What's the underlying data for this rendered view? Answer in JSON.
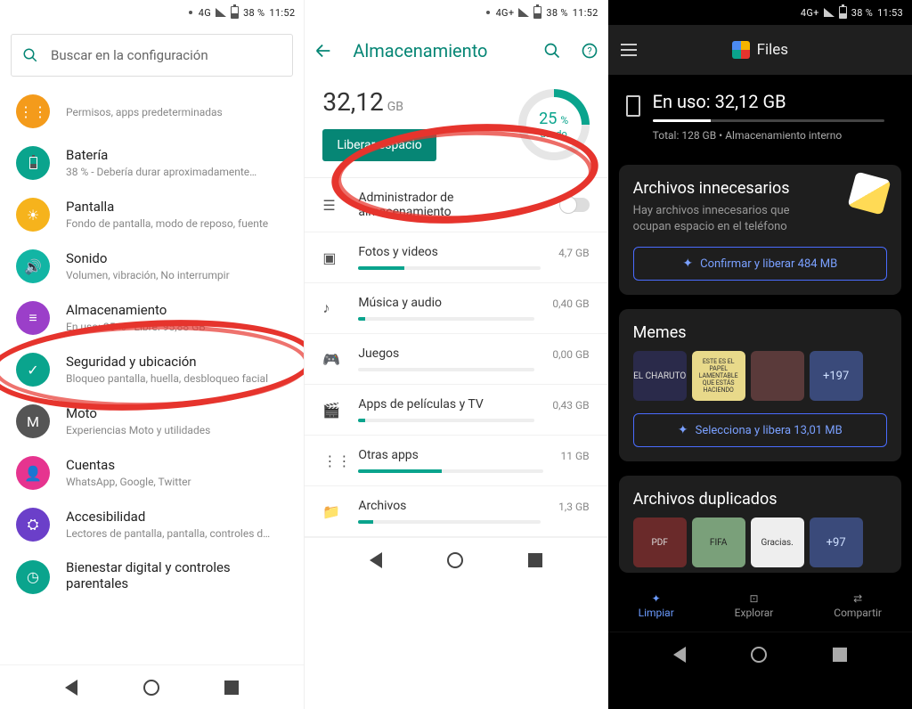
{
  "status": {
    "net": "4G",
    "batt": "38 %",
    "time1": "11:52",
    "time3": "11:53",
    "netplus": "4G+"
  },
  "p1": {
    "search_placeholder": "Buscar en la configuración",
    "items": [
      {
        "title": "",
        "sub": "Permisos, apps predeterminadas",
        "color": "#f49b1b"
      },
      {
        "title": "Batería",
        "sub": "38 % - Debería durar aproximadamente…",
        "color": "#0aa48d"
      },
      {
        "title": "Pantalla",
        "sub": "Fondo de pantalla, modo de reposo, fuente",
        "color": "#f6b31c"
      },
      {
        "title": "Sonido",
        "sub": "Volumen, vibración, No interrumpir",
        "color": "#12b5a4"
      },
      {
        "title": "Almacenamiento",
        "sub": "En uso: 25 % - Libre: 95,88 GB",
        "color": "#9b3fc9"
      },
      {
        "title": "Seguridad y ubicación",
        "sub": "Bloqueo pantalla, huella, desbloqueo facial",
        "color": "#0aa48d"
      },
      {
        "title": "Moto",
        "sub": "Experiencias Moto y utilidades",
        "color": "#555"
      },
      {
        "title": "Cuentas",
        "sub": "WhatsApp, Google, Twitter",
        "color": "#e6348f"
      },
      {
        "title": "Accesibilidad",
        "sub": "Lectores de pantalla, pantalla, controles d…",
        "color": "#6b3fc9"
      },
      {
        "title": "Bienestar digital y controles parentales",
        "sub": "",
        "color": "#0aa48d"
      }
    ]
  },
  "p2": {
    "title": "Almacenamiento",
    "used_num": "32,12",
    "used_unit": "GB",
    "free_btn": "Liberar espacio",
    "ring_pct": "25",
    "ring_pct_sym": "%",
    "ring_label": "usado",
    "mgr_title": "Administrador de almacenamiento",
    "cats": [
      {
        "t": "Fotos y videos",
        "v": "4,7 GB",
        "w": 25
      },
      {
        "t": "Música y audio",
        "v": "0,40 GB",
        "w": 4
      },
      {
        "t": "Juegos",
        "v": "0,00 GB",
        "w": 0
      },
      {
        "t": "Apps de películas y TV",
        "v": "0,43 GB",
        "w": 4
      },
      {
        "t": "Otras apps",
        "v": "11 GB",
        "w": 45
      },
      {
        "t": "Archivos",
        "v": "1,3 GB",
        "w": 8
      }
    ]
  },
  "p3": {
    "app": "Files",
    "use_label": "En uso: 32,12 GB",
    "total": "Total: 128 GB • Almacenamiento interno",
    "card1_t": "Archivos innecesarios",
    "card1_s": "Hay archivos innecesarios que ocupan espacio en el teléfono",
    "card1_btn": "Confirmar y liberar 484 MB",
    "card2_t": "Memes",
    "card2_more": "+197",
    "card2_btn": "Selecciona y libera 13,01 MB",
    "card3_t": "Archivos duplicados",
    "card3_more": "+97",
    "thumbs2": [
      "EL CHARUTO",
      "ESTE ES EL PAPEL LAMENTABLE QUE ESTÁS HACIENDO",
      ""
    ],
    "thumbs3": [
      "PDF",
      "FIFA",
      "Gracias."
    ],
    "tabs": {
      "a": "Limpiar",
      "b": "Explorar",
      "c": "Compartir"
    }
  }
}
